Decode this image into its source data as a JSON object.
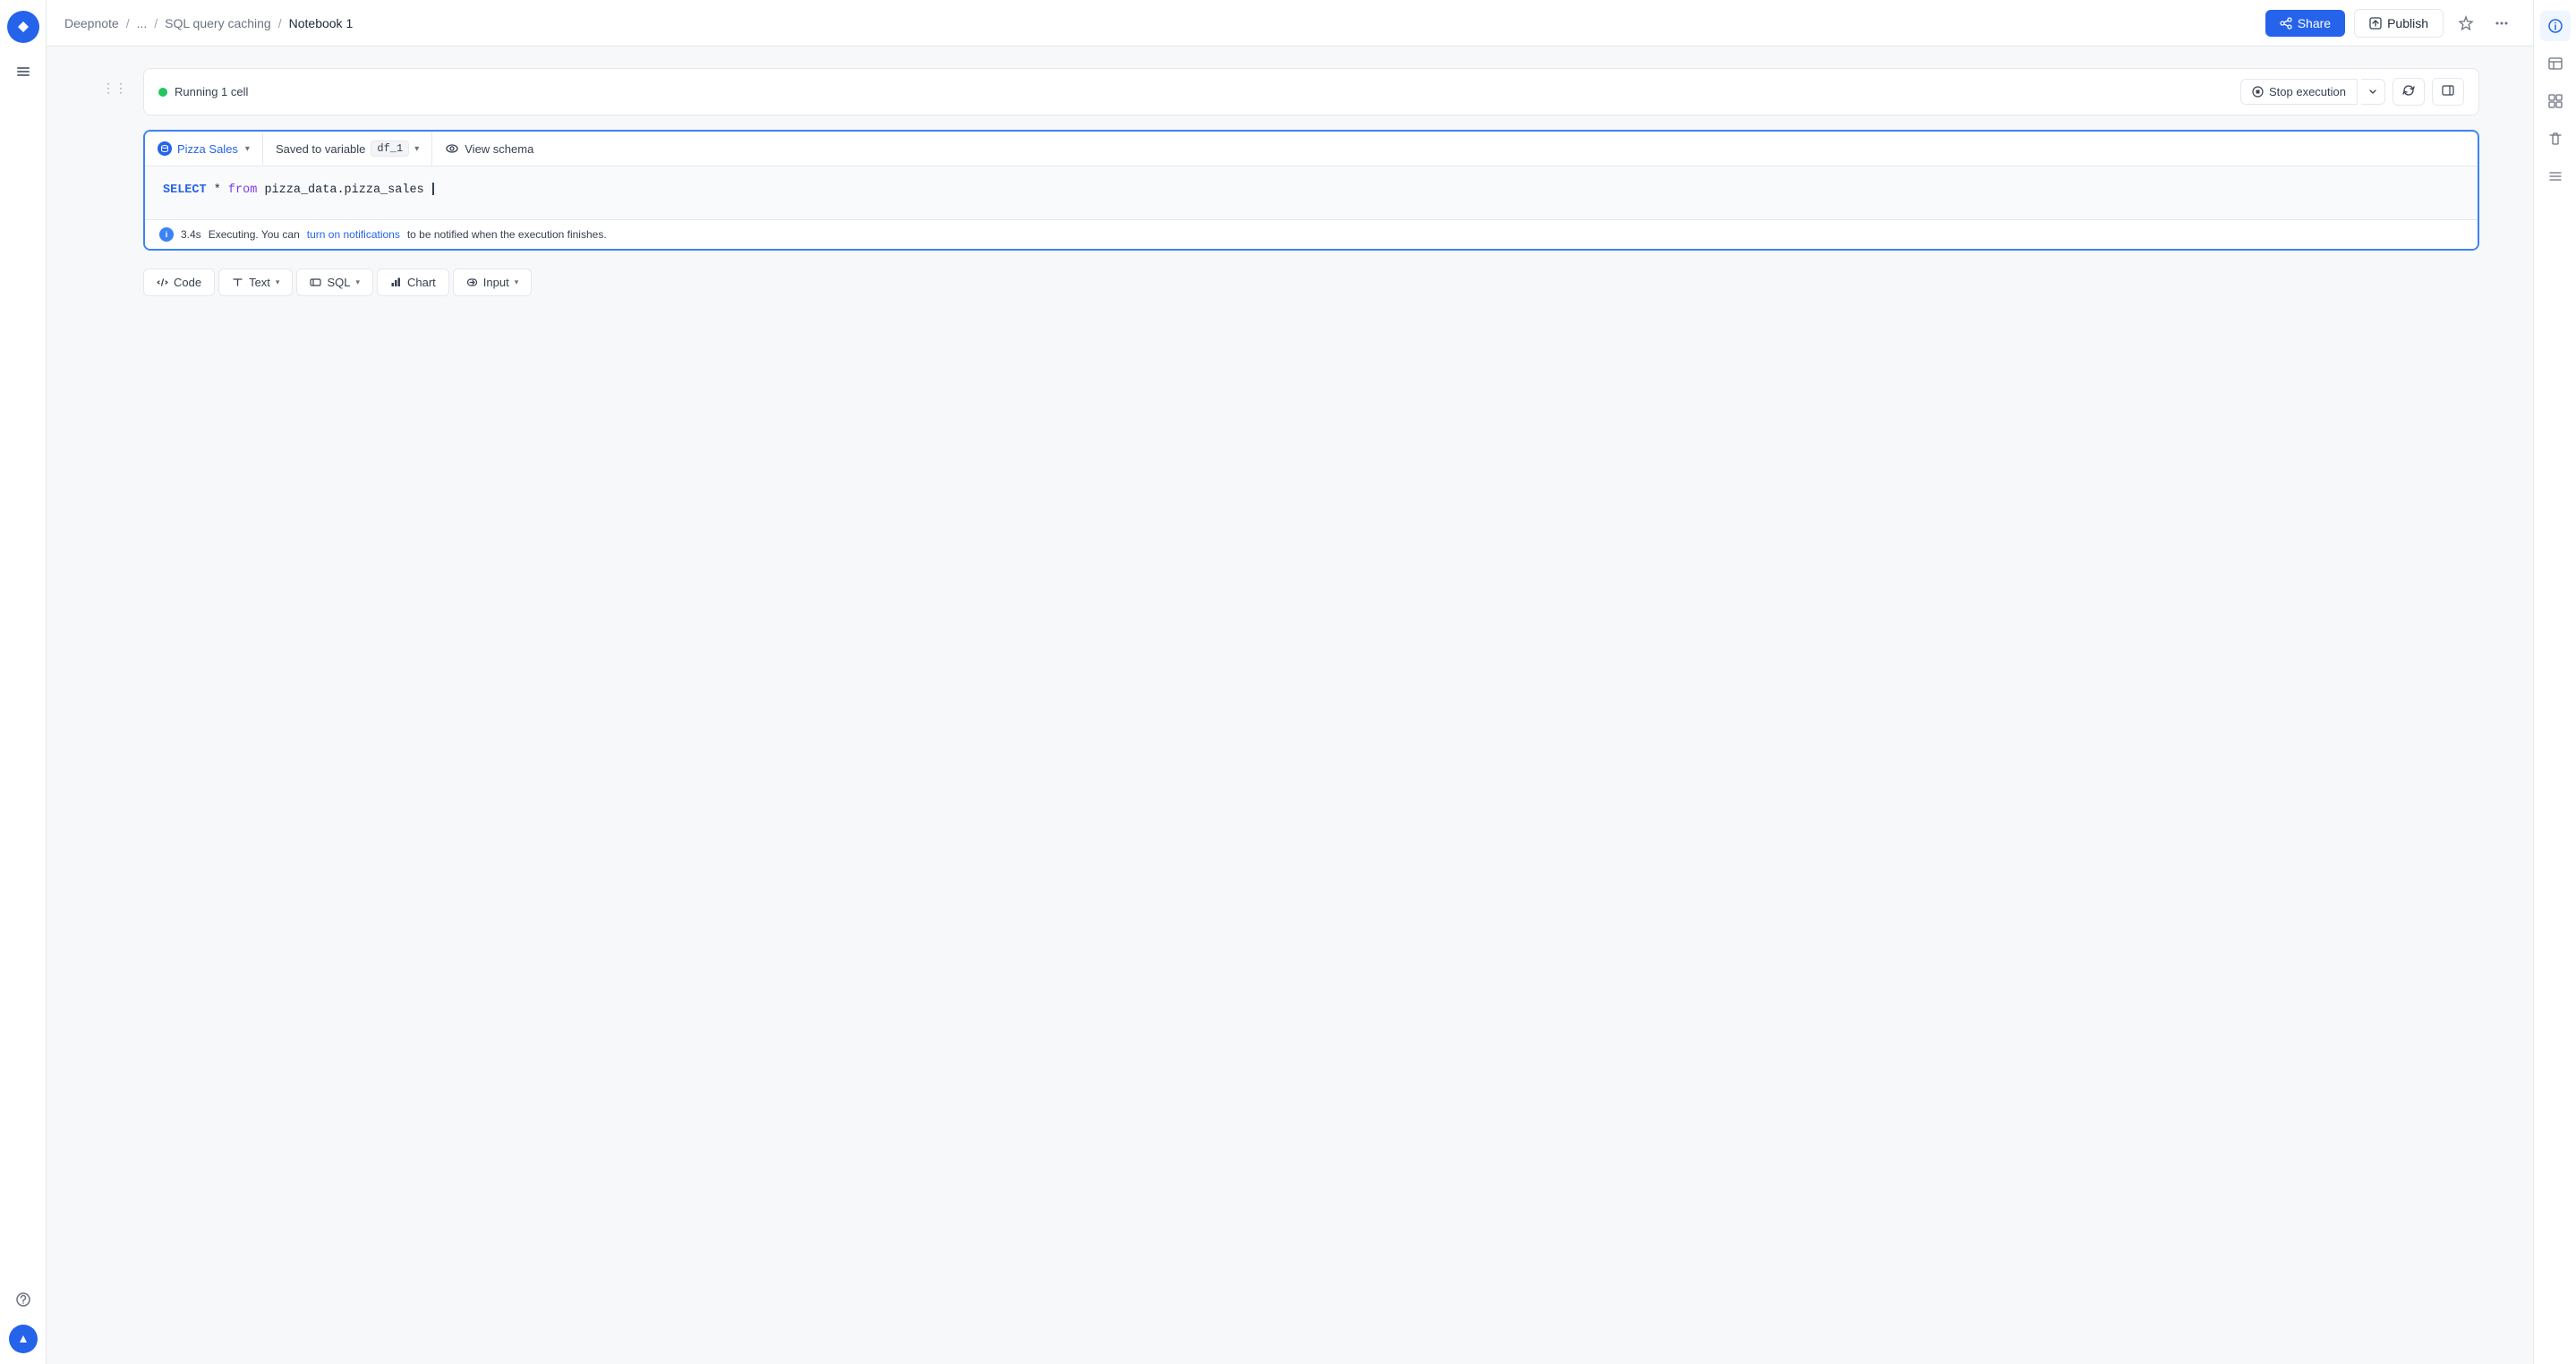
{
  "sidebar": {
    "logo": "D",
    "icons": [
      "menu"
    ]
  },
  "topbar": {
    "breadcrumbs": [
      {
        "label": "Deepnote",
        "link": true
      },
      {
        "label": "...",
        "link": true
      },
      {
        "label": "SQL query caching",
        "link": true
      },
      {
        "label": "Notebook 1",
        "current": true
      }
    ],
    "share_label": "Share",
    "publish_label": "Publish"
  },
  "status_bar": {
    "running_text": "Running 1 cell",
    "stop_label": "Stop execution",
    "indicator": "green"
  },
  "sql_cell": {
    "tab_label": "Pizza Sales",
    "saved_var_prefix": "Saved to variable",
    "variable_name": "df_1",
    "view_schema_label": "View schema",
    "code": "SELECT * from pizza_data.pizza_sales",
    "code_keyword": "SELECT",
    "code_from": "from",
    "code_table": "pizza_data.pizza_sales",
    "exec_time": "3.4s",
    "exec_text": "Executing. You can",
    "exec_link": "turn on notifications",
    "exec_suffix": "to be notified when the execution finishes."
  },
  "add_toolbar": {
    "code_label": "Code",
    "text_label": "Text",
    "text_chevron": "▾",
    "sql_label": "SQL",
    "sql_chevron": "▾",
    "chart_label": "Chart",
    "input_label": "Input",
    "input_chevron": "▾"
  },
  "right_sidebar": {
    "icons": [
      "info",
      "table",
      "grid",
      "trash",
      "list"
    ]
  }
}
